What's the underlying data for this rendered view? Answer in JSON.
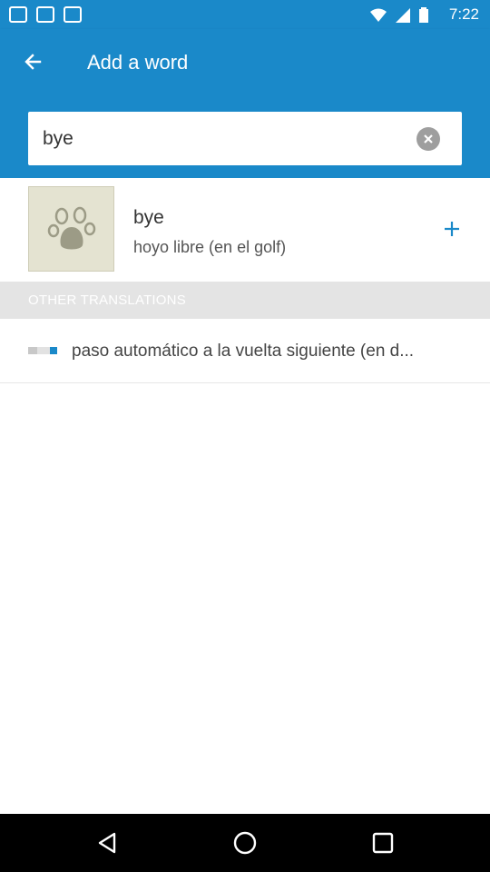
{
  "status_bar": {
    "time": "7:22"
  },
  "app_bar": {
    "title": "Add a word"
  },
  "search": {
    "value": "bye"
  },
  "result": {
    "word": "bye",
    "translation": "hoyo libre (en el golf)"
  },
  "section": {
    "other_translations_label": "OTHER TRANSLATIONS"
  },
  "other_translations": [
    {
      "text": "paso automático a la vuelta siguiente (en d..."
    }
  ],
  "colors": {
    "primary": "#1a89c9",
    "section_bg": "#e4e4e4",
    "thumb_bg": "#e4e3d1"
  },
  "icons": {
    "back": "arrow-left-icon",
    "clear": "clear-circle-icon",
    "add": "plus-icon",
    "thumbnail": "paw-icon",
    "nav_back": "triangle-back-icon",
    "nav_home": "circle-home-icon",
    "nav_recent": "square-recent-icon"
  }
}
